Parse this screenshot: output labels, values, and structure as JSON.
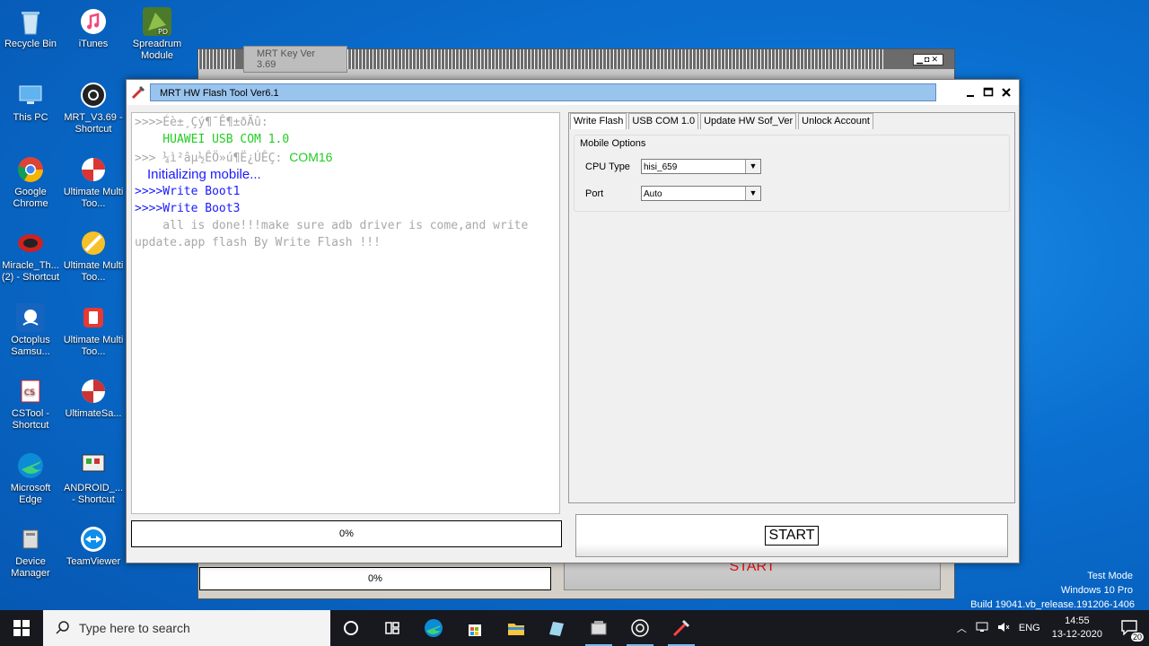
{
  "desktop": {
    "icons": [
      {
        "label": "Recycle Bin",
        "icon": "recycle-bin-icon"
      },
      {
        "label": "iTunes",
        "icon": "itunes-icon"
      },
      {
        "label": "Spreadrum Module",
        "icon": "spreadrum-icon"
      },
      {
        "label": "This PC",
        "icon": "this-pc-icon"
      },
      {
        "label": "MRT_V3.69 - Shortcut",
        "icon": "mrt-icon"
      },
      {
        "label": "Google Chrome",
        "icon": "chrome-icon"
      },
      {
        "label": "Ultimate Multi Too...",
        "icon": "ultimate-multi-tool-icon"
      },
      {
        "label": "Miracle_Th... (2) - Shortcut",
        "icon": "miracle-icon"
      },
      {
        "label": "Ultimate Multi Too...",
        "icon": "ultimate-multi-tool-icon"
      },
      {
        "label": "Octoplus Samsu...",
        "icon": "octoplus-icon"
      },
      {
        "label": "Ultimate Multi Too...",
        "icon": "ultimate-multi-tool-icon"
      },
      {
        "label": "CSTool - Shortcut",
        "icon": "cstool-icon"
      },
      {
        "label": "UltimateSa...",
        "icon": "ultimate-sa-icon"
      },
      {
        "label": "Microsoft Edge",
        "icon": "edge-icon"
      },
      {
        "label": "ANDROID_... - Shortcut",
        "icon": "android-icon"
      },
      {
        "label": "Device Manager",
        "icon": "device-manager-icon"
      },
      {
        "label": "TeamViewer",
        "icon": "teamviewer-icon"
      }
    ]
  },
  "back_window": {
    "title": "MRT Key Ver 3.69",
    "progress": "0%",
    "start_label": "START"
  },
  "front_window": {
    "title": "MRT HW Flash Tool Ver6.1",
    "log": [
      ">>>>Éè±¸Çý¶¯Ê¶±ðÃû:",
      "    HUAWEI USB COM 1.0",
      ">>> ¼ì²âµ½ÊÖ»ú¶Ë¿ÚÊÇ: ",
      "COM16",
      "Initializing mobile...",
      ">>>>Write Boot1",
      ">>>>Write Boot3",
      "    all is done!!!make sure adb driver is come,and write",
      "update.app flash By Write Flash !!!"
    ],
    "progress": "0%",
    "tabs": [
      "Write Flash",
      "USB COM 1.0",
      "Update HW Sof_Ver",
      "Unlock Account"
    ],
    "group_label": "Mobile Options",
    "cpu_type_label": "CPU Type",
    "cpu_type_value": "hisi_659",
    "port_label": "Port",
    "port_value": "Auto",
    "start_label": "START"
  },
  "watermark": {
    "line1": "Test Mode",
    "line2": "Windows 10 Pro",
    "line3": "Build 19041.vb_release.191206-1406"
  },
  "taskbar": {
    "search_placeholder": "Type here to search",
    "lang": "ENG",
    "time": "14:55",
    "date": "13-12-2020",
    "notif_count": "20"
  }
}
